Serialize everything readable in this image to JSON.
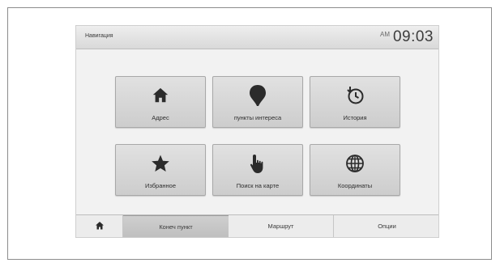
{
  "header": {
    "title": "Навигация",
    "clock_small": "AM",
    "time": "09:03"
  },
  "tiles": [
    {
      "label": "Адрес",
      "icon": "home-icon"
    },
    {
      "label": "пункты интереса",
      "icon": "map-pin-icon"
    },
    {
      "label": "История",
      "icon": "history-clock-icon"
    },
    {
      "label": "Избранное",
      "icon": "star-icon"
    },
    {
      "label": "Поиск на карте",
      "icon": "hand-pointer-icon"
    },
    {
      "label": "Координаты",
      "icon": "globe-icon"
    }
  ],
  "tabs": {
    "home_icon": "home-icon",
    "end_point": "Конеч пункт",
    "route": "Маршрут",
    "options": "Опции"
  },
  "colors": {
    "icon": "#2b2b2b",
    "tile": "#d6d6d6",
    "active_tab": "#c4c4c4"
  }
}
